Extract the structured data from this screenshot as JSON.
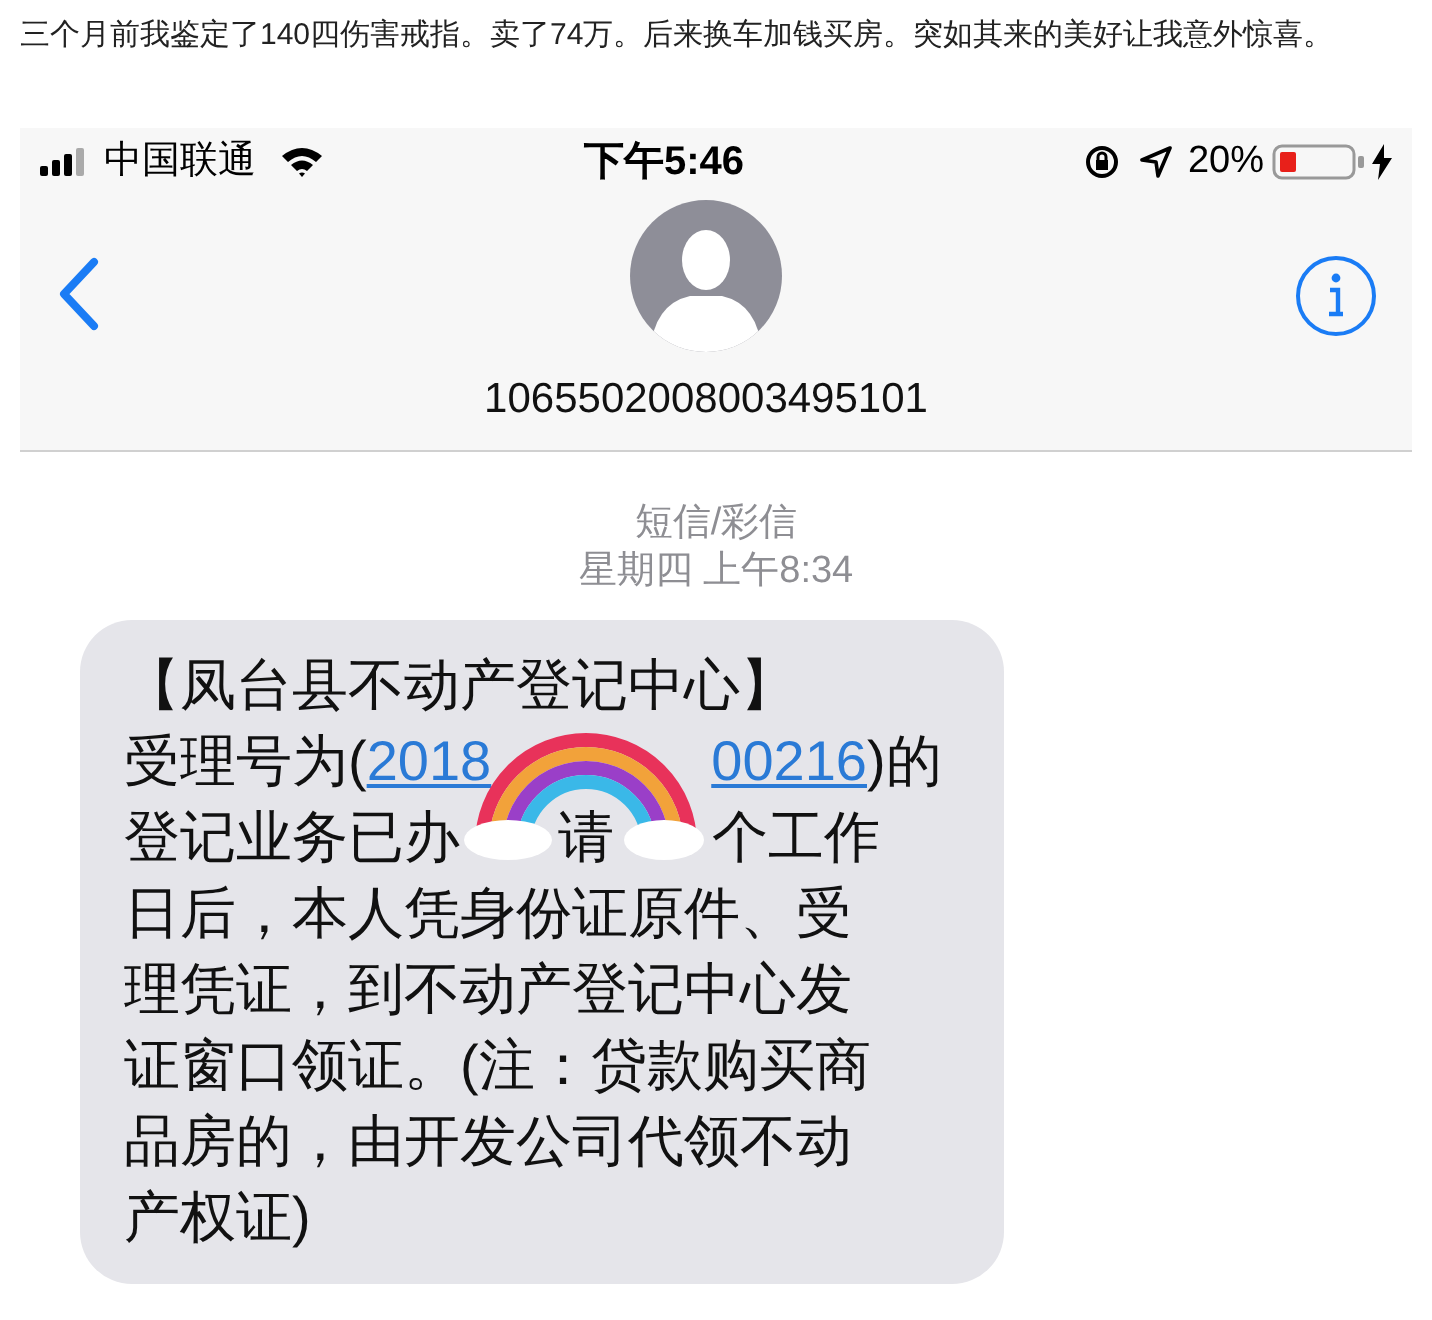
{
  "post": {
    "text": "三个月前我鉴定了140四伤害戒指。卖了74万。后来换车加钱买房。突如其来的美好让我意外惊喜。"
  },
  "status_bar": {
    "carrier": "中国联通",
    "time": "下午5:46",
    "battery": "20%"
  },
  "conversation": {
    "contact": "1065502008003495101"
  },
  "thread": {
    "service": "短信/彩信",
    "timestamp": "星期四 上午8:34"
  },
  "message": {
    "lines": [
      [
        [
          {
            "kind": "text",
            "text": "【凤台县不动产登记中心】"
          }
        ]
      ],
      [
        [
          {
            "kind": "text",
            "text": "受理号为("
          },
          {
            "kind": "link",
            "text": "2018"
          }
        ],
        [
          {
            "kind": "link",
            "text": "00216"
          },
          {
            "kind": "text",
            "text": ")的"
          }
        ]
      ],
      [
        [
          {
            "kind": "text",
            "text": "登记业务已办"
          }
        ],
        [
          {
            "kind": "text",
            "text": "请"
          }
        ],
        [
          {
            "kind": "text",
            "text": "个工作"
          }
        ]
      ],
      [
        [
          {
            "kind": "text",
            "text": "日后，本人凭身份证原件、受"
          }
        ]
      ],
      [
        [
          {
            "kind": "text",
            "text": "理凭证，到不动产登记中心发"
          }
        ]
      ],
      [
        [
          {
            "kind": "text",
            "text": "证窗口领证。(注：贷款购买商"
          }
        ]
      ],
      [
        [
          {
            "kind": "text",
            "text": "品房的，由开发公司代领不动"
          }
        ]
      ],
      [
        [
          {
            "kind": "text",
            "text": "产权证)"
          }
        ]
      ]
    ]
  }
}
